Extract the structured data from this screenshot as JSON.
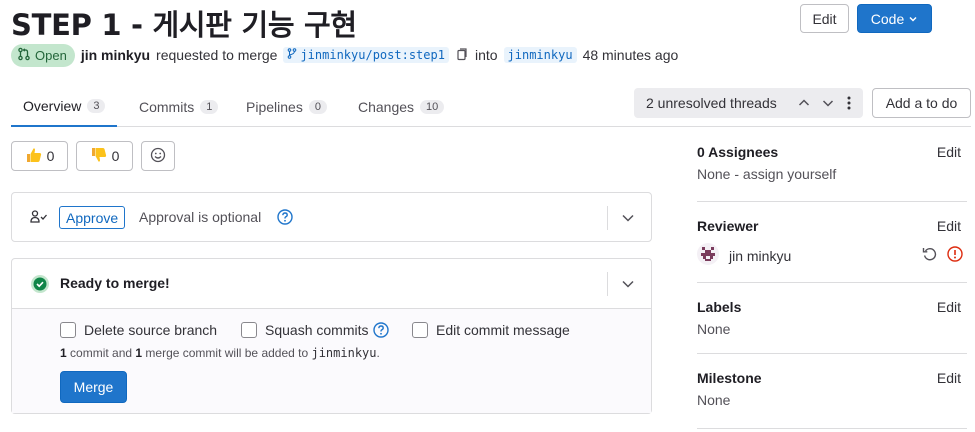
{
  "header": {
    "title": "STEP 1 - 게시판 기능 구현",
    "edit_label": "Edit",
    "code_label": "Code"
  },
  "meta": {
    "status": "Open",
    "author": "jin minkyu",
    "action": "requested to merge",
    "source_branch": "jinminkyu/post:step1",
    "into": "into",
    "target_branch": "jinminkyu",
    "time": "48 minutes ago"
  },
  "tabs": [
    {
      "label": "Overview",
      "count": "3"
    },
    {
      "label": "Commits",
      "count": "1"
    },
    {
      "label": "Pipelines",
      "count": "0"
    },
    {
      "label": "Changes",
      "count": "10"
    }
  ],
  "threads": {
    "label": "2 unresolved threads"
  },
  "todo": {
    "label": "Add a to do"
  },
  "reactions": {
    "thumbs_up": "0",
    "thumbs_down": "0"
  },
  "approval": {
    "button": "Approve",
    "text": "Approval is optional"
  },
  "merge": {
    "status": "Ready to merge!",
    "options": [
      "Delete source branch",
      "Squash commits",
      "Edit commit message"
    ],
    "info_count1": "1",
    "info_part1": " commit and ",
    "info_count2": "1",
    "info_part2": " merge commit will be added to ",
    "info_branch": "jinminkyu",
    "info_end": ".",
    "button": "Merge"
  },
  "sidebar": {
    "assignees": {
      "title": "0 Assignees",
      "edit": "Edit",
      "value": "None - assign yourself"
    },
    "reviewer": {
      "title": "Reviewer",
      "edit": "Edit",
      "name": "jin minkyu"
    },
    "labels": {
      "title": "Labels",
      "edit": "Edit",
      "value": "None"
    },
    "milestone": {
      "title": "Milestone",
      "edit": "Edit",
      "value": "None"
    }
  },
  "colors": {
    "accent": "#1f75cb",
    "success": "#108548",
    "danger": "#dd2b0e"
  }
}
